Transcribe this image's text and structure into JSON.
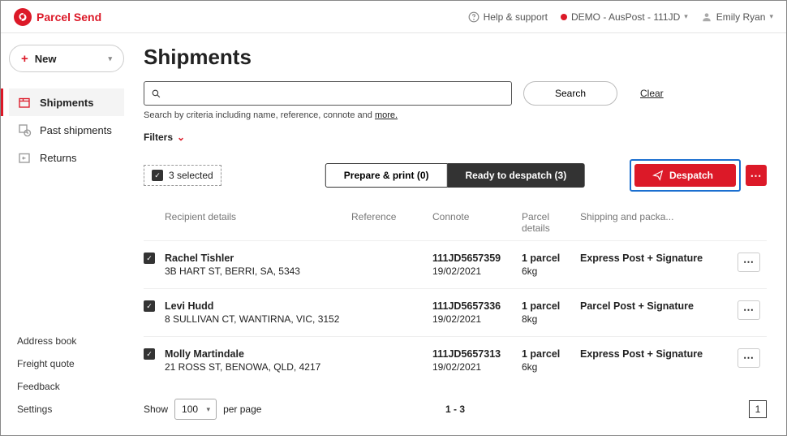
{
  "brand": "Parcel Send",
  "topbar": {
    "help": "Help & support",
    "account": "DEMO - AusPost - 111JD",
    "user": "Emily Ryan"
  },
  "new_button": {
    "label": "New"
  },
  "nav": {
    "shipments": "Shipments",
    "past": "Past shipments",
    "returns": "Returns"
  },
  "footer_nav": {
    "address": "Address book",
    "freight": "Freight quote",
    "feedback": "Feedback",
    "settings": "Settings"
  },
  "page_title": "Shipments",
  "search": {
    "button": "Search",
    "clear": "Clear",
    "hint_prefix": "Search by criteria including name, reference, connote and ",
    "hint_link": "more."
  },
  "filters_label": "Filters",
  "selected_label": "3 selected",
  "segment": {
    "prepare": "Prepare & print (0)",
    "ready": "Ready to despatch (3)"
  },
  "despatch_label": "Despatch",
  "columns": {
    "recipient": "Recipient details",
    "reference": "Reference",
    "connote": "Connote",
    "parcel": "Parcel details",
    "shipping": "Shipping and packa..."
  },
  "rows": [
    {
      "name": "Rachel Tishler",
      "addr": "3B HART ST, BERRI, SA, 5343",
      "connote": "111JD5657359",
      "date": "19/02/2021",
      "parcels": "1 parcel",
      "weight": "6kg",
      "shipping": "Express Post + Signature"
    },
    {
      "name": "Levi Hudd",
      "addr": "8 SULLIVAN CT, WANTIRNA, VIC, 3152",
      "connote": "111JD5657336",
      "date": "19/02/2021",
      "parcels": "1 parcel",
      "weight": "8kg",
      "shipping": "Parcel Post + Signature"
    },
    {
      "name": "Molly Martindale",
      "addr": "21 ROSS ST, BENOWA, QLD, 4217",
      "connote": "111JD5657313",
      "date": "19/02/2021",
      "parcels": "1 parcel",
      "weight": "6kg",
      "shipping": "Express Post + Signature"
    }
  ],
  "pagination": {
    "show": "Show",
    "per_page": "per page",
    "value": "100",
    "range": "1 - 3",
    "page": "1"
  }
}
